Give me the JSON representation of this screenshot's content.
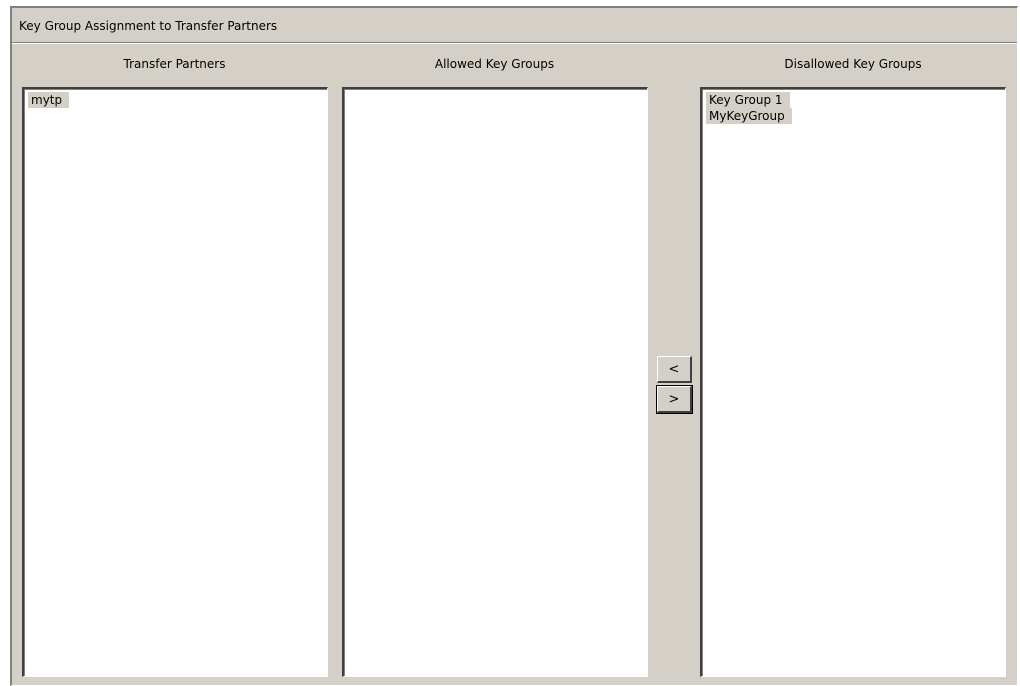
{
  "title": "Key Group Assignment to Transfer Partners",
  "columns": {
    "transfer_partners": {
      "header": "Transfer Partners",
      "items": [
        "mytp"
      ]
    },
    "allowed_key_groups": {
      "header": "Allowed Key Groups",
      "items": []
    },
    "disallowed_key_groups": {
      "header": "Disallowed Key Groups",
      "items": [
        "Key Group 1",
        "MyKeyGroup"
      ]
    }
  },
  "buttons": {
    "move_left": "<",
    "move_right": ">"
  },
  "colors": {
    "panel_background": "#d4d0c8",
    "list_background": "#ffffff",
    "item_highlight": "#d4d0c8"
  }
}
